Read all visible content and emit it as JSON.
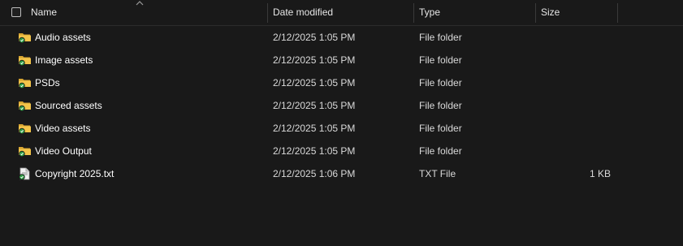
{
  "header": {
    "name": "Name",
    "date_modified": "Date modified",
    "type": "Type",
    "size": "Size"
  },
  "colors": {
    "background": "#191919",
    "text": "#ffffff",
    "folder": "#f4c54a",
    "sync_badge": "#2f9e44"
  },
  "rows": [
    {
      "name": "Audio assets",
      "date": "2/12/2025 1:05 PM",
      "type": "File folder",
      "size": "",
      "icon": "folder-icon"
    },
    {
      "name": "Image assets",
      "date": "2/12/2025 1:05 PM",
      "type": "File folder",
      "size": "",
      "icon": "folder-icon"
    },
    {
      "name": "PSDs",
      "date": "2/12/2025 1:05 PM",
      "type": "File folder",
      "size": "",
      "icon": "folder-icon"
    },
    {
      "name": "Sourced assets",
      "date": "2/12/2025 1:05 PM",
      "type": "File folder",
      "size": "",
      "icon": "folder-icon"
    },
    {
      "name": "Video assets",
      "date": "2/12/2025 1:05 PM",
      "type": "File folder",
      "size": "",
      "icon": "folder-icon"
    },
    {
      "name": "Video Output",
      "date": "2/12/2025 1:05 PM",
      "type": "File folder",
      "size": "",
      "icon": "folder-icon"
    },
    {
      "name": "Copyright 2025.txt",
      "date": "2/12/2025 1:06 PM",
      "type": "TXT File",
      "size": "1 KB",
      "icon": "text-file-icon"
    }
  ]
}
